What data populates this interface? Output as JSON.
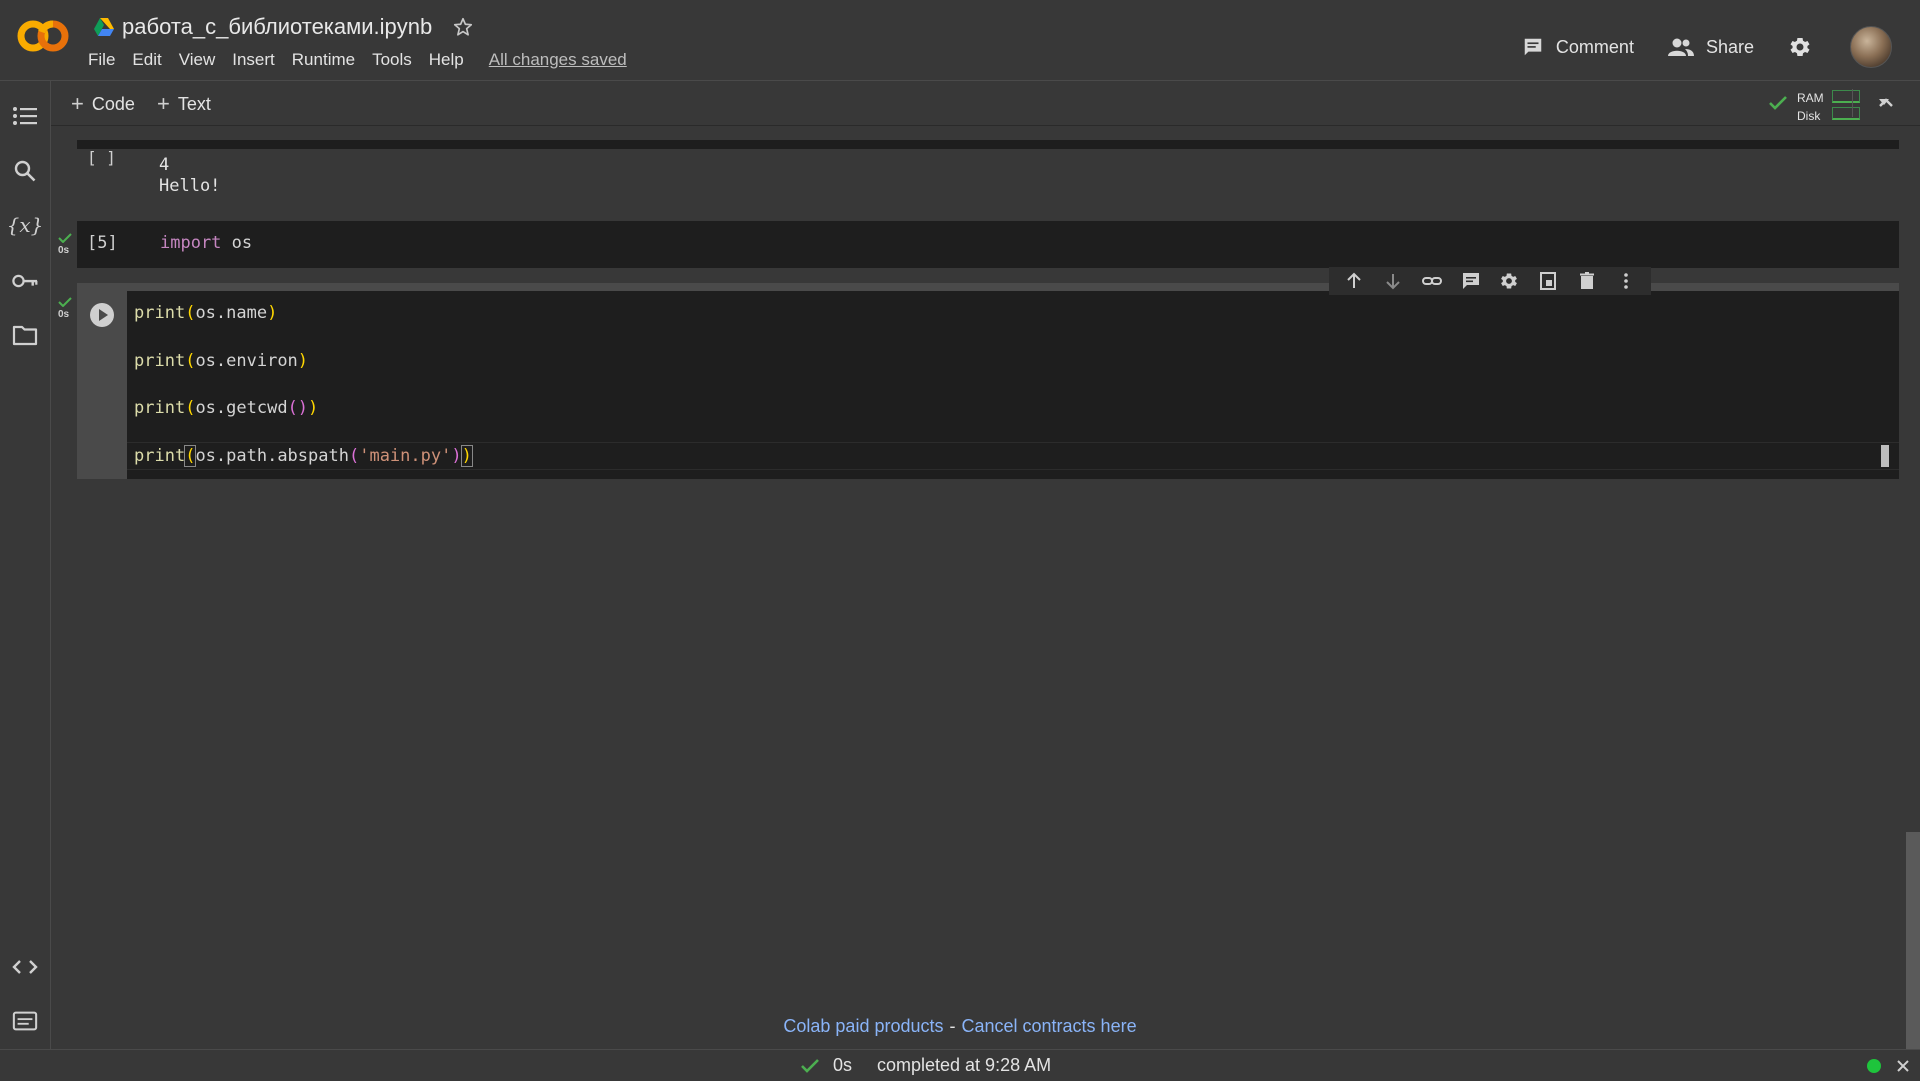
{
  "header": {
    "app_name": "Colab",
    "document_title": "работа_с_библиотеками.ipynb",
    "menu": [
      "File",
      "Edit",
      "View",
      "Insert",
      "Runtime",
      "Tools",
      "Help"
    ],
    "save_status": "All changes saved",
    "comment_label": "Comment",
    "share_label": "Share"
  },
  "toolbar": {
    "add_code_label": "Code",
    "add_text_label": "Text",
    "ram_label": "RAM",
    "disk_label": "Disk"
  },
  "cells": {
    "output_cell": {
      "exec_count": "[ ]",
      "output_lines": [
        "4",
        "Hello!"
      ]
    },
    "import_cell": {
      "exec_count": "[5]",
      "status_time": "0s",
      "code_keyword": "import",
      "code_rest": " os"
    },
    "active_cell": {
      "status_time": "0s",
      "lines": [
        [
          "print",
          "(",
          "os.name",
          ")"
        ],
        [
          "print",
          "(",
          "os.environ",
          ")"
        ],
        [
          "print",
          "(",
          "os.getcwd",
          "()",
          ")"
        ],
        [
          "print",
          "(",
          "os.path.abspath",
          "(",
          "'main.py'",
          ")",
          ")"
        ]
      ]
    }
  },
  "footer": {
    "paid_products": "Colab paid products",
    "separator": "-",
    "cancel_contracts": "Cancel contracts here"
  },
  "statusbar": {
    "elapsed": "0s",
    "completed_text": "completed at 9:28 AM"
  },
  "colors": {
    "background": "#383838",
    "cell_background": "#1e1e1e",
    "link": "#8ab4f8",
    "success": "#4caf50",
    "keyword": "#c586c0"
  },
  "icons": [
    "colab-logo",
    "drive-icon",
    "star-icon",
    "comment-icon",
    "share-icon",
    "settings-icon",
    "toc-icon",
    "search-icon",
    "variables-icon",
    "secrets-icon",
    "files-icon",
    "code-snippets-icon",
    "terminal-icon",
    "run-icon",
    "check-icon"
  ]
}
